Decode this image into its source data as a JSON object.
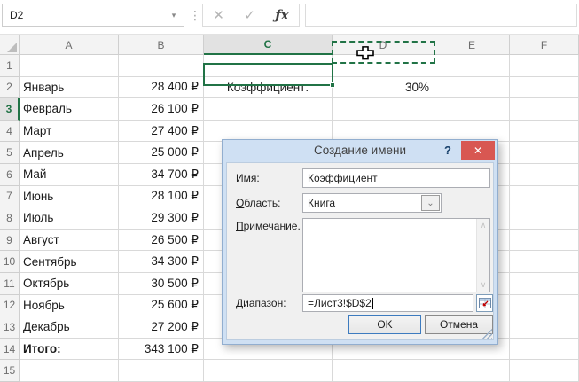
{
  "app": {
    "name_box_value": "D2",
    "formula_bar_value": "",
    "icons": {
      "namebox_arrow": "▾",
      "dots": "⋮",
      "cancel": "✕",
      "enter": "✓",
      "function": "ƒx"
    }
  },
  "grid": {
    "column_headers": [
      "A",
      "B",
      "C",
      "D",
      "E",
      "F"
    ],
    "row_count": 15,
    "selected_column": "C",
    "selected_row": 3,
    "active_cell": "C3",
    "referenced_cell": "D2",
    "cells": {
      "C2": "Коэффициент:",
      "D2": "30%"
    },
    "rows": [
      {
        "month": "Январь",
        "amount": "28 400 ₽"
      },
      {
        "month": "Февраль",
        "amount": "26 100 ₽"
      },
      {
        "month": "Март",
        "amount": "27 400 ₽"
      },
      {
        "month": "Апрель",
        "amount": "25 000 ₽"
      },
      {
        "month": "Май",
        "amount": "34 700 ₽"
      },
      {
        "month": "Июнь",
        "amount": "28 100 ₽"
      },
      {
        "month": "Июль",
        "amount": "29 300 ₽"
      },
      {
        "month": "Август",
        "amount": "26 500 ₽"
      },
      {
        "month": "Сентябрь",
        "amount": "34 300 ₽"
      },
      {
        "month": "Октябрь",
        "amount": "30 500 ₽"
      },
      {
        "month": "Ноябрь",
        "amount": "25 600 ₽"
      },
      {
        "month": "Декабрь",
        "amount": "27 200 ₽"
      }
    ],
    "total_row": {
      "label": "Итого:",
      "amount": "343 100 ₽"
    }
  },
  "dialog": {
    "title": "Создание имени",
    "help_label": "?",
    "close_label": "✕",
    "fields": {
      "name": {
        "label_pre": "",
        "label_key": "И",
        "label_post": "мя:",
        "value": "Коэффициент"
      },
      "scope": {
        "label_pre": "",
        "label_key": "О",
        "label_post": "бласть:",
        "value": "Книга"
      },
      "comment": {
        "label_pre": "",
        "label_key": "П",
        "label_post": "римечание.",
        "value": ""
      },
      "range": {
        "label_pre": "Диапа",
        "label_key": "з",
        "label_post": "он:",
        "value": "=Лист3!$D$2"
      }
    },
    "buttons": {
      "ok": "OK",
      "cancel": "Отмена"
    }
  },
  "colors": {
    "excel_green": "#217346",
    "dialog_frame": "#cfe0f3",
    "close_red": "#d85752",
    "header_selected_bg": "#e2e2e2"
  }
}
